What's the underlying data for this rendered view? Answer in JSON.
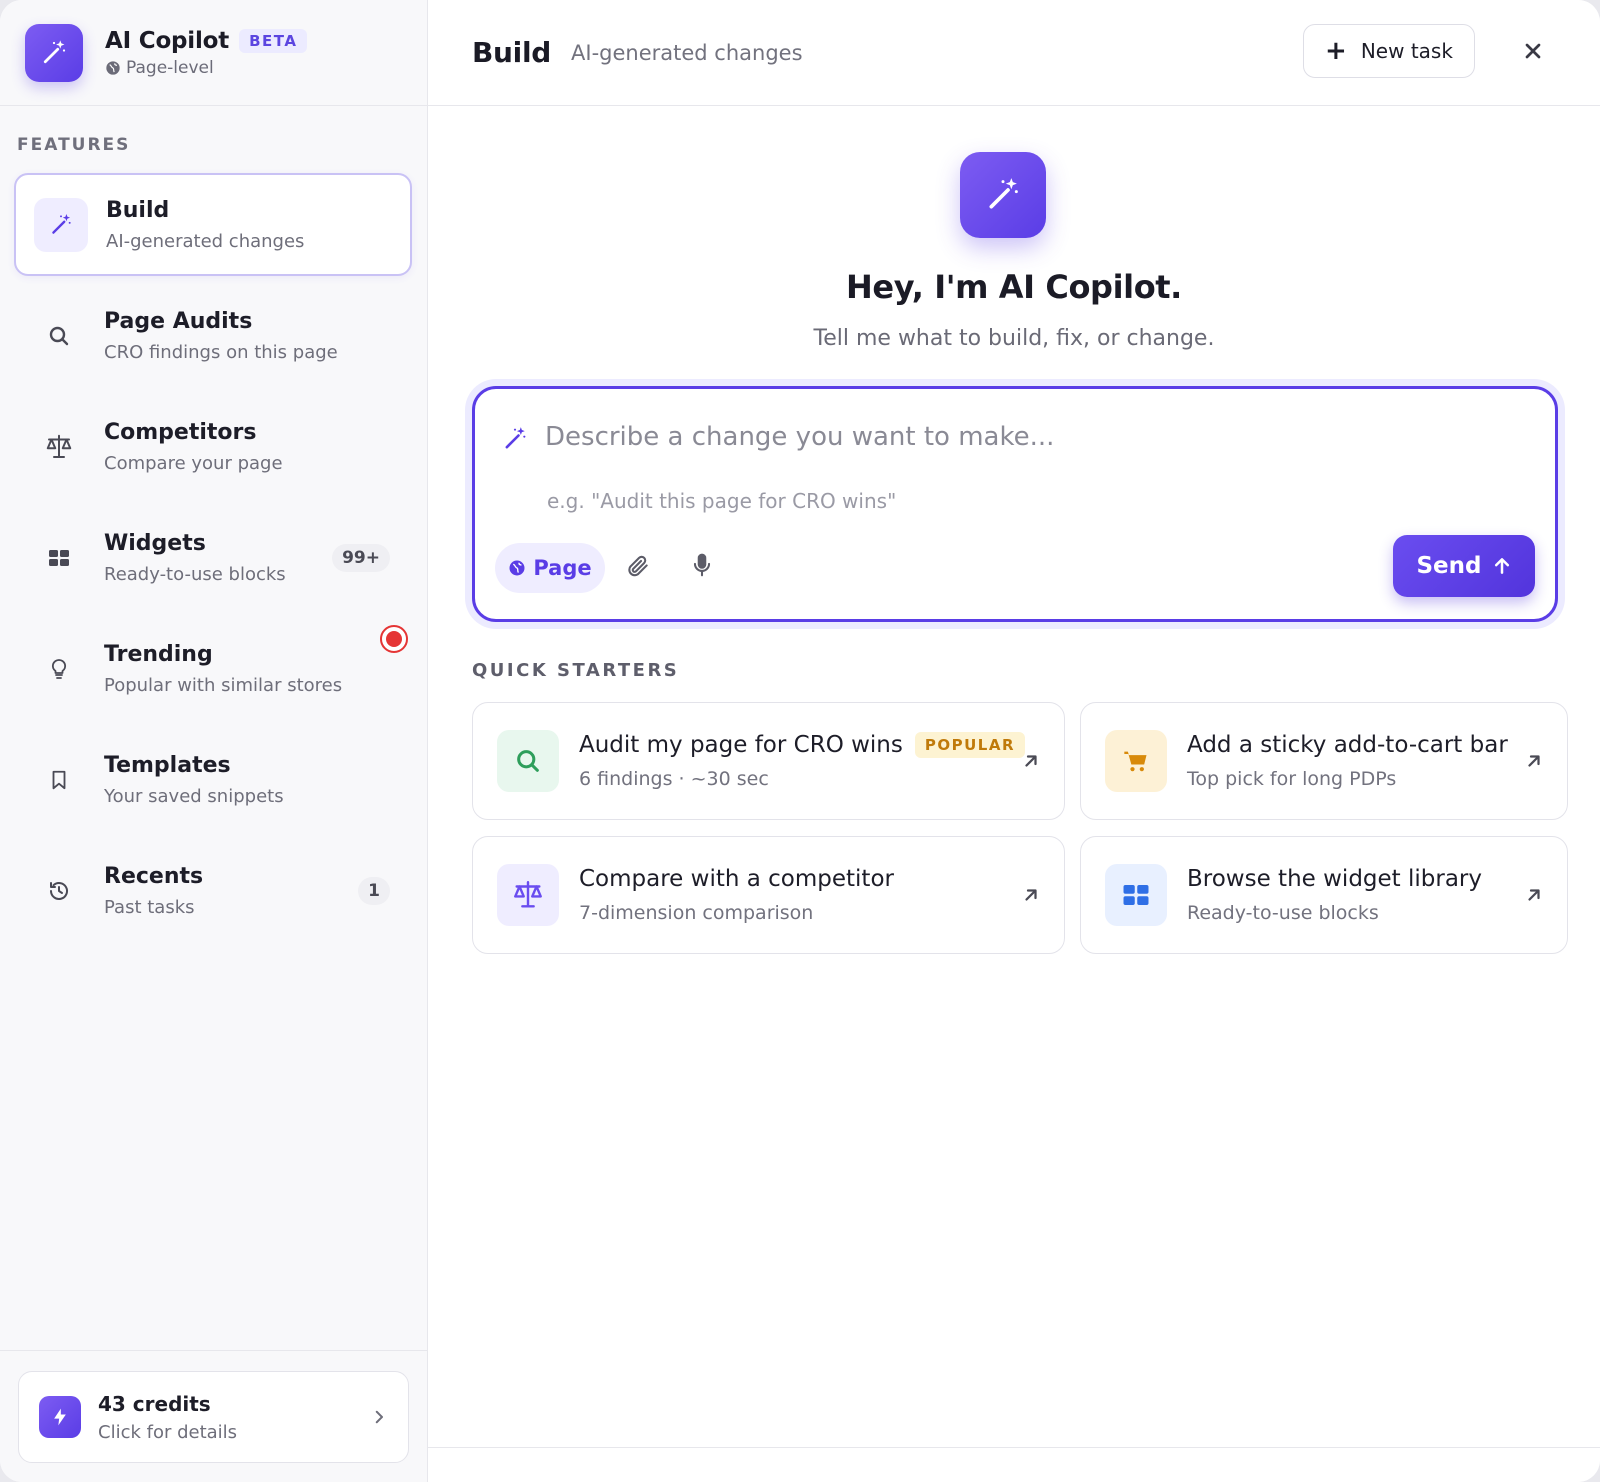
{
  "brand": {
    "name": "AI Copilot",
    "badge": "BETA",
    "scope": "Page-level",
    "accent_color": "#5a3de6"
  },
  "sidebar": {
    "section_label": "FEATURES",
    "items": [
      {
        "title": "Build",
        "subtitle": "AI-generated changes",
        "icon": "magic-wand-icon",
        "active": true
      },
      {
        "title": "Page Audits",
        "subtitle": "CRO findings on this page",
        "icon": "search-icon"
      },
      {
        "title": "Competitors",
        "subtitle": "Compare your page",
        "icon": "scale-icon"
      },
      {
        "title": "Widgets",
        "subtitle": "Ready-to-use blocks",
        "icon": "grid-icon",
        "count": "99+"
      },
      {
        "title": "Trending",
        "subtitle": "Popular with similar stores",
        "icon": "lightbulb-icon",
        "live_indicator": true
      },
      {
        "title": "Templates",
        "subtitle": "Your saved snippets",
        "icon": "bookmark-icon"
      },
      {
        "title": "Recents",
        "subtitle": "Past tasks",
        "icon": "history-icon",
        "count": "1"
      }
    ],
    "credits": {
      "title": "43 credits",
      "subtitle": "Click for details",
      "icon": "lightning-icon"
    }
  },
  "header": {
    "title": "Build",
    "subtitle": "AI-generated changes",
    "new_task_label": "New task"
  },
  "hero": {
    "title": "Hey, I'm AI Copilot.",
    "subtitle": "Tell me what to build, fix, or change."
  },
  "composer": {
    "placeholder": "Describe a change you want to make...",
    "value": "",
    "hint": "e.g. \"Audit this page for CRO wins\"",
    "scope_chip": "Page",
    "send_label": "Send"
  },
  "quick_starters": {
    "label": "QUICK STARTERS",
    "items": [
      {
        "title": "Audit my page for CRO wins",
        "subtitle": "6 findings · ~30 sec",
        "badge": "POPULAR",
        "icon": "search-icon",
        "icon_color": "#2e9e5b",
        "icon_bg": "#e8f7ee"
      },
      {
        "title": "Add a sticky add-to-cart bar",
        "subtitle": "Top pick for long PDPs",
        "icon": "cart-icon",
        "icon_color": "#d88a0a",
        "icon_bg": "#fdf1d6"
      },
      {
        "title": "Compare with a competitor",
        "subtitle": "7-dimension comparison",
        "icon": "scale-icon",
        "icon_color": "#6a4df0",
        "icon_bg": "#efedff"
      },
      {
        "title": "Browse the widget library",
        "subtitle": "Ready-to-use blocks",
        "icon": "grid-icon",
        "icon_color": "#2f6fe6",
        "icon_bg": "#e8f0ff"
      }
    ]
  }
}
